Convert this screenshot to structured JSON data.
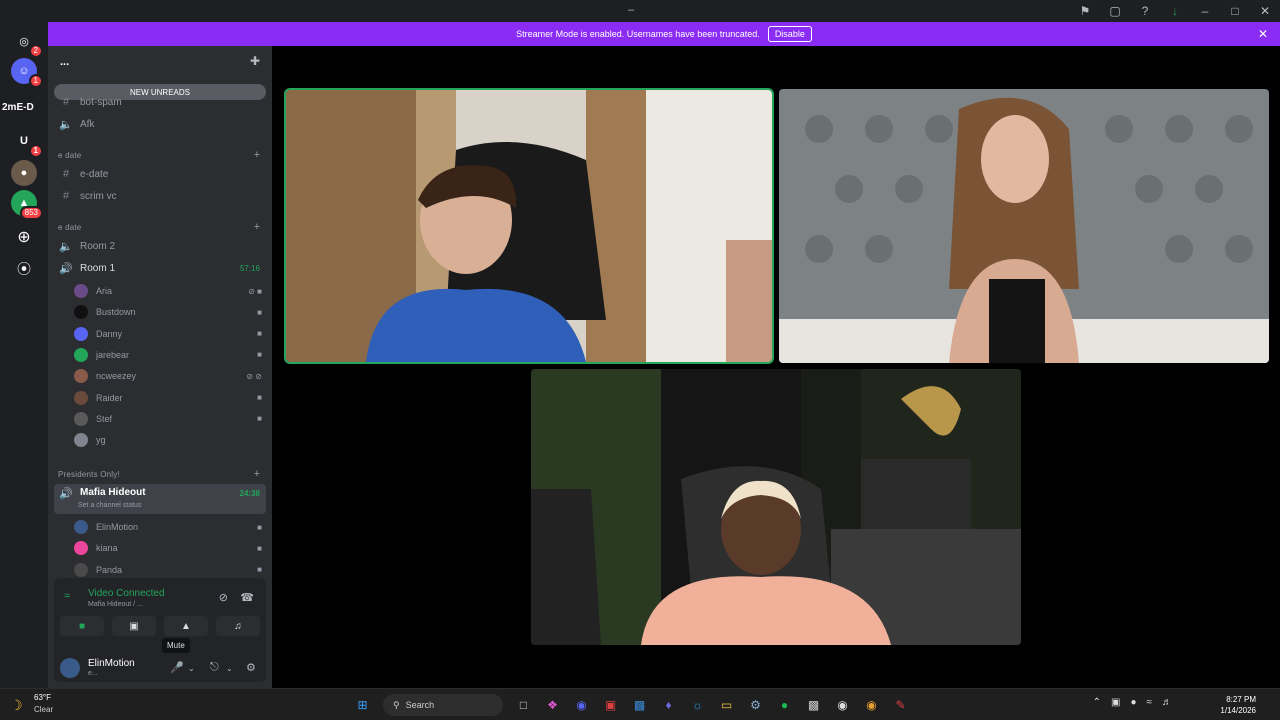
{
  "window": {
    "title": "–"
  },
  "banner": {
    "text": "Streamer Mode is enabled. Usernames have been truncated.",
    "disable_label": "Disable"
  },
  "guilds": {
    "badges": [
      "2",
      "1",
      "1",
      "853"
    ],
    "text_item": "2mE-D"
  },
  "server": {
    "name": "..."
  },
  "sidebar": {
    "new_unreads": "NEW UNREADS",
    "top_channels": [
      {
        "name": "bot-spam"
      },
      {
        "name": "Afk"
      }
    ],
    "categories": [
      "e date",
      "e date",
      "Presidents Only!"
    ],
    "cat1_channels": [
      {
        "name": "e-date"
      },
      {
        "name": "scrim vc"
      }
    ],
    "cat2_channels": [
      {
        "name": "Room 2"
      },
      {
        "name": "Room 1",
        "timer": "57:16"
      }
    ],
    "room1_members": [
      {
        "name": "Aria",
        "icons": "⊘ ■",
        "color": "#6b4a8a"
      },
      {
        "name": "Bustdown",
        "icons": "■",
        "color": "#111111"
      },
      {
        "name": "Danny",
        "icons": "■",
        "color": "#5865f2"
      },
      {
        "name": "jarebear",
        "icons": "■",
        "color": "#23a55a"
      },
      {
        "name": "ncweezey",
        "icons": "⊘ ⊘",
        "color": "#8a5a4a"
      },
      {
        "name": "Raider",
        "icons": "■",
        "color": "#6a4a3a"
      },
      {
        "name": "Stef",
        "icons": "■",
        "color": "#5a5a5a"
      },
      {
        "name": "yg",
        "icons": "",
        "color": "#80848e"
      }
    ],
    "mafia": {
      "name": "Mafia Hideout",
      "timer": "24:38",
      "status": "Set a channel status"
    },
    "mafia_members": [
      {
        "name": "ElinMotion",
        "icons": "■",
        "color": "#3a5a8a"
      },
      {
        "name": "kiana",
        "icons": "■",
        "color": "#eb459e"
      },
      {
        "name": "Panda",
        "icons": "■",
        "color": "#4a4a4a"
      }
    ]
  },
  "voice_panel": {
    "status": "Video Connected",
    "channel": "Mafia Hideout / ...",
    "tooltip": "Mute"
  },
  "user": {
    "name": "ElinMotion",
    "status": "e..."
  },
  "taskbar": {
    "temp": "63°F",
    "condition": "Clear",
    "search_placeholder": "Search",
    "time": "8:27 PM",
    "date": "1/14/2026"
  },
  "colors": {
    "accent": "#23a55a",
    "banner": "#8b2cf5",
    "brand": "#5865f2"
  }
}
